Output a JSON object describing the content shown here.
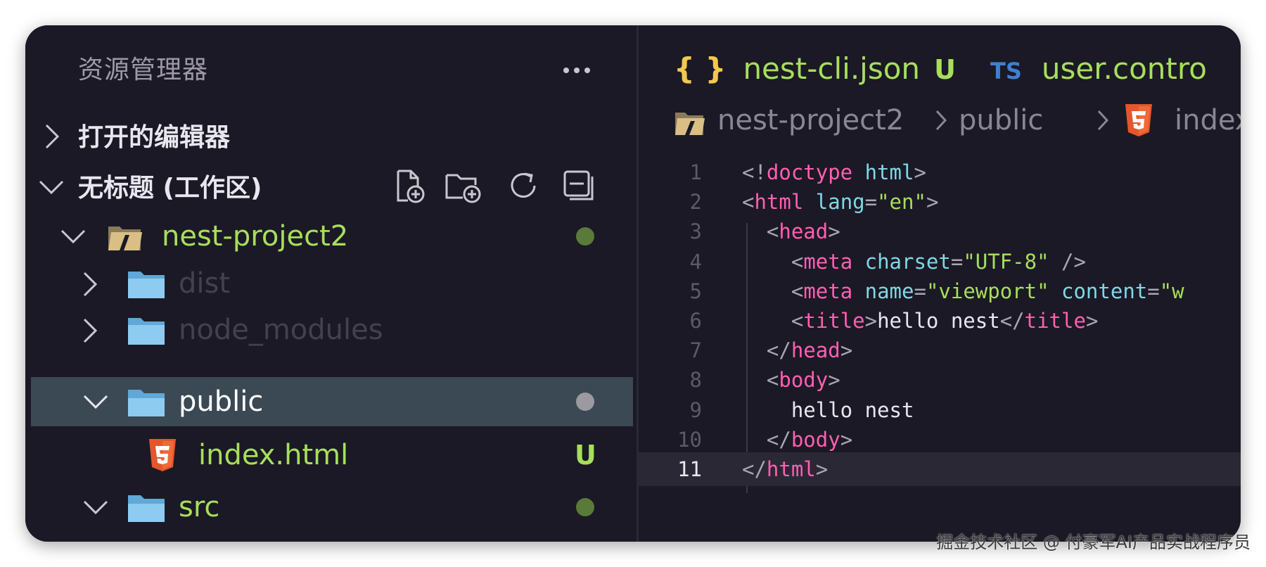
{
  "explorer": {
    "title": "资源管理器",
    "open_editors": "打开的编辑器",
    "workspace": "无标题 (工作区)"
  },
  "tree": [
    {
      "label": "nest-project2",
      "color": "#a7df5b",
      "status": "dot",
      "status_color": "#5a7a3a"
    },
    {
      "label": "dist",
      "color": "#44414f",
      "status": "",
      "status_color": ""
    },
    {
      "label": "node_modules",
      "color": "#44414f",
      "status": "",
      "status_color": ""
    },
    {
      "label": "public",
      "color": "#ffffff",
      "status": "dot",
      "status_color": "#9a9aa0"
    },
    {
      "label": "index.html",
      "color": "#a7df5b",
      "status": "U",
      "status_color": "#a7df5b"
    },
    {
      "label": "src",
      "color": "#a7df5b",
      "status": "dot",
      "status_color": "#5a7a3a"
    }
  ],
  "tabs": [
    {
      "icon": "{ }",
      "label": "nest-cli.json",
      "badge": "U"
    },
    {
      "icon": "TS",
      "label": "user.contro"
    }
  ],
  "breadcrumb": [
    "nest-project2",
    "public",
    "index."
  ],
  "code": {
    "current_line": 11,
    "lines": [
      {
        "n": "1",
        "segs": [
          [
            "br",
            "<!"
          ],
          [
            "tag",
            "doctype"
          ],
          [
            "txt",
            " "
          ],
          [
            "attr",
            "html"
          ],
          [
            "br",
            ">"
          ]
        ]
      },
      {
        "n": "2",
        "segs": [
          [
            "br",
            "<"
          ],
          [
            "tag",
            "html"
          ],
          [
            "txt",
            " "
          ],
          [
            "attr",
            "lang"
          ],
          [
            "br",
            "="
          ],
          [
            "str",
            "\"en\""
          ],
          [
            "br",
            ">"
          ]
        ]
      },
      {
        "n": "3",
        "segs": [
          [
            "txt",
            "  "
          ],
          [
            "br",
            "<"
          ],
          [
            "tag",
            "head"
          ],
          [
            "br",
            ">"
          ]
        ]
      },
      {
        "n": "4",
        "segs": [
          [
            "txt",
            "    "
          ],
          [
            "br",
            "<"
          ],
          [
            "tag",
            "meta"
          ],
          [
            "txt",
            " "
          ],
          [
            "attr",
            "charset"
          ],
          [
            "br",
            "="
          ],
          [
            "str",
            "\"UTF-8\""
          ],
          [
            "txt",
            " "
          ],
          [
            "br",
            "/>"
          ]
        ]
      },
      {
        "n": "5",
        "segs": [
          [
            "txt",
            "    "
          ],
          [
            "br",
            "<"
          ],
          [
            "tag",
            "meta"
          ],
          [
            "txt",
            " "
          ],
          [
            "attr",
            "name"
          ],
          [
            "br",
            "="
          ],
          [
            "str",
            "\"viewport\""
          ],
          [
            "txt",
            " "
          ],
          [
            "attr",
            "content"
          ],
          [
            "br",
            "="
          ],
          [
            "str",
            "\"w"
          ]
        ]
      },
      {
        "n": "6",
        "segs": [
          [
            "txt",
            "    "
          ],
          [
            "br",
            "<"
          ],
          [
            "tag",
            "title"
          ],
          [
            "br",
            ">"
          ],
          [
            "txt",
            "hello nest"
          ],
          [
            "br",
            "</"
          ],
          [
            "tag",
            "title"
          ],
          [
            "br",
            ">"
          ]
        ]
      },
      {
        "n": "7",
        "segs": [
          [
            "txt",
            "  "
          ],
          [
            "br",
            "</"
          ],
          [
            "tag",
            "head"
          ],
          [
            "br",
            ">"
          ]
        ]
      },
      {
        "n": "8",
        "segs": [
          [
            "txt",
            "  "
          ],
          [
            "br",
            "<"
          ],
          [
            "tag",
            "body"
          ],
          [
            "br",
            ">"
          ]
        ]
      },
      {
        "n": "9",
        "segs": [
          [
            "txt",
            "    hello nest"
          ]
        ]
      },
      {
        "n": "10",
        "segs": [
          [
            "txt",
            "  "
          ],
          [
            "br",
            "</"
          ],
          [
            "tag",
            "body"
          ],
          [
            "br",
            ">"
          ]
        ]
      },
      {
        "n": "11",
        "segs": [
          [
            "br",
            "</"
          ],
          [
            "tag",
            "html"
          ],
          [
            "br",
            ">"
          ]
        ]
      }
    ]
  },
  "watermark": "掘金技术社区 @ 付豪军AI产品实战程序员"
}
